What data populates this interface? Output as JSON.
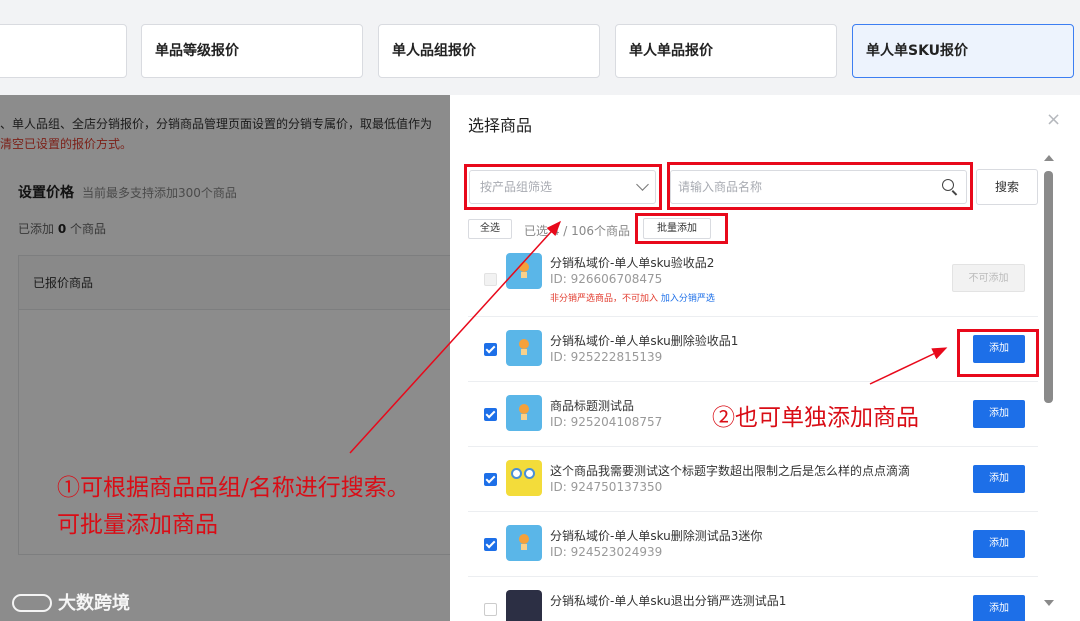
{
  "tabs": [
    {
      "label": "",
      "active": false
    },
    {
      "label": "单品等级报价",
      "active": false
    },
    {
      "label": "单人品组报价",
      "active": false
    },
    {
      "label": "单人单品报价",
      "active": false
    },
    {
      "label": "单人单SKU报价",
      "active": true
    }
  ],
  "page": {
    "notice_line1": "、单人品组、全店分销报价，分销商品管理页面设置的分销专属价，取最低值作为",
    "notice_line2": "清空已设置的报价方式。",
    "section_title": "设置价格",
    "section_subtitle": "当前最多支持添加300个商品",
    "added_prefix": "已添加",
    "added_count": "0",
    "added_suffix": "个商品",
    "table_header": "已报价商品"
  },
  "drawer": {
    "title": "选择商品",
    "close": "×",
    "group_filter_placeholder": "按产品组筛选",
    "search_placeholder": "请输入商品名称",
    "search_button": "搜索",
    "select_all": "全选",
    "selected_count": "已选 4 / 106个商品",
    "batch_add": "批量添加",
    "products": [
      {
        "name": "分销私域价-单人单sku验收品2",
        "id": "ID: 926606708475",
        "warning": "非分销严选商品，不可加入",
        "warning_link": "加入分销严选",
        "action": "不可添加",
        "state": "disabled"
      },
      {
        "name": "分销私域价-单人单sku删除验收品1",
        "id": "ID: 925222815139",
        "action": "添加",
        "state": "checked"
      },
      {
        "name": "商品标题测试品",
        "id": "ID: 925204108757",
        "action": "添加",
        "state": "checked"
      },
      {
        "name": "这个商品我需要测试这个标题字数超出限制之后是怎么样的点点滴滴",
        "id": "ID: 924750137350",
        "action": "添加",
        "state": "checked"
      },
      {
        "name": "分销私域价-单人单sku删除测试品3迷你",
        "id": "ID: 924523024939",
        "action": "添加",
        "state": "checked"
      },
      {
        "name": "分销私域价-单人单sku退出分销严选测试品1",
        "id": "",
        "action": "添加",
        "state": "unchecked"
      }
    ]
  },
  "annotations": {
    "note1_line1": "①可根据商品品组/名称进行搜索。",
    "note1_line2": "可批量添加商品",
    "note2": "②也可单独添加商品",
    "color": "#e8091b"
  },
  "watermark": "大数跨境",
  "colors": {
    "primary": "#1d6fe8",
    "danger": "#e23c2f",
    "active_tab_bg": "#edf3fd"
  }
}
